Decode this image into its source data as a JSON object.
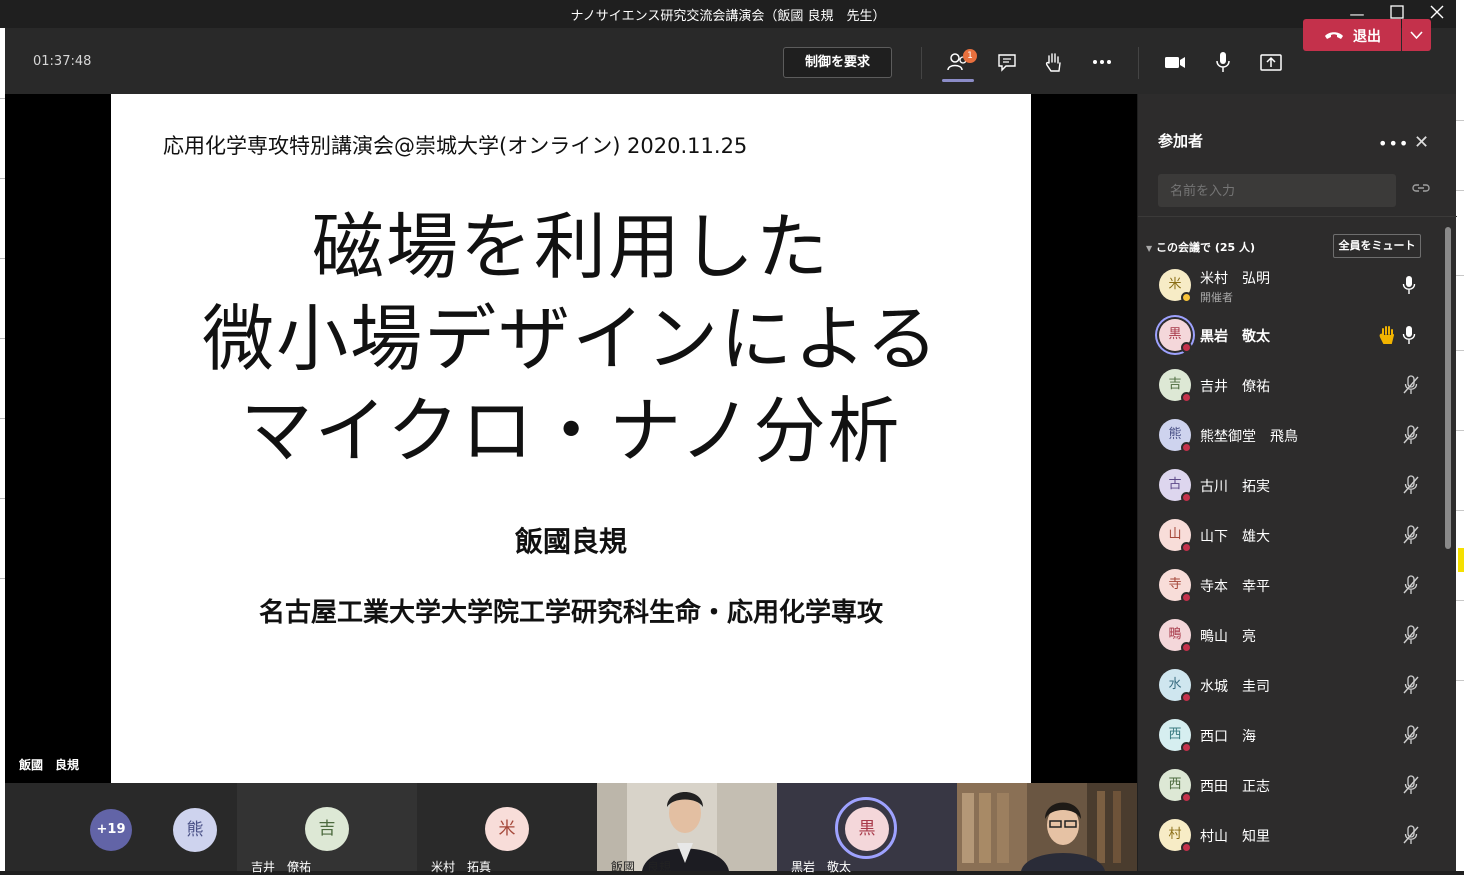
{
  "window": {
    "title": "ナノサイエンス研究交流会講演会（飯國 良規　先生）"
  },
  "toolbar": {
    "timer": "01:37:48",
    "control_label": "制御を要求",
    "participants_badge": "1",
    "leave_label": "退出"
  },
  "slide": {
    "header": "応用化学専攻特別講演会@崇城大学(オンライン)  2020.11.25",
    "title_line1": "磁場を利用した",
    "title_line2": "微小場デザインによる",
    "title_line3": "マイクロ・ナノ分析",
    "author": "飯國良規",
    "affiliation": "名古屋工業大学大学院工学研究科生命・応用化学専攻"
  },
  "presenter_label": "飯國　良規",
  "strip": {
    "more_count": "+19",
    "tiles": [
      {
        "initial": "熊",
        "name": ""
      },
      {
        "initial": "吉",
        "name": "吉井　僚祐"
      },
      {
        "initial": "米",
        "name": "米村　拓真"
      },
      {
        "initial": "",
        "name": "飯國　良規"
      },
      {
        "initial": "黒",
        "name": "黒岩　敬太"
      },
      {
        "initial": "",
        "name": ""
      }
    ]
  },
  "panel": {
    "title": "参加者",
    "search_placeholder": "名前を入力",
    "section_label": "この会議で (25 人)",
    "mute_all": "全員をミュート",
    "participants": [
      {
        "initial": "米",
        "name": "米村　弘明",
        "role": "開催者",
        "mic": "on",
        "hand": false
      },
      {
        "initial": "黒",
        "name": "黒岩　敬太",
        "role": "",
        "mic": "on",
        "hand": true
      },
      {
        "initial": "吉",
        "name": "吉井　僚祐",
        "role": "",
        "mic": "muted",
        "hand": false
      },
      {
        "initial": "熊",
        "name": "熊埜御堂　飛鳥",
        "role": "",
        "mic": "muted",
        "hand": false
      },
      {
        "initial": "古",
        "name": "古川　拓実",
        "role": "",
        "mic": "muted",
        "hand": false
      },
      {
        "initial": "山",
        "name": "山下　雄大",
        "role": "",
        "mic": "muted",
        "hand": false
      },
      {
        "initial": "寺",
        "name": "寺本　幸平",
        "role": "",
        "mic": "muted",
        "hand": false
      },
      {
        "initial": "鴫",
        "name": "鴫山　亮",
        "role": "",
        "mic": "muted",
        "hand": false
      },
      {
        "initial": "水",
        "name": "水城　圭司",
        "role": "",
        "mic": "muted",
        "hand": false
      },
      {
        "initial": "西",
        "name": "西口　海",
        "role": "",
        "mic": "muted",
        "hand": false
      },
      {
        "initial": "西",
        "name": "西田　正志",
        "role": "",
        "mic": "muted",
        "hand": false
      },
      {
        "initial": "村",
        "name": "村山　知里",
        "role": "",
        "mic": "muted",
        "hand": false
      }
    ]
  }
}
